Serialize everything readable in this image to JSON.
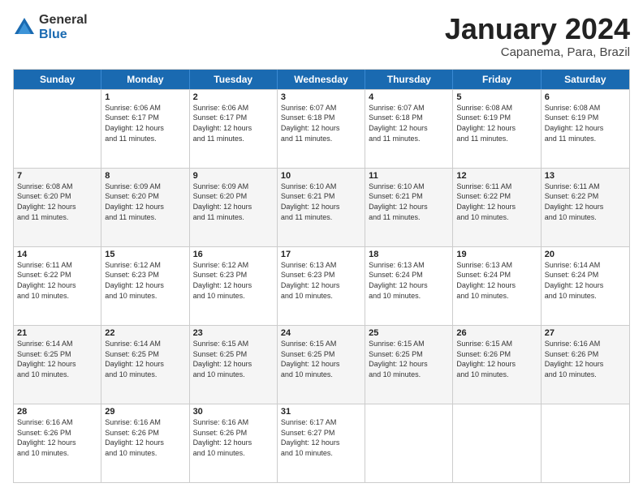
{
  "logo": {
    "general": "General",
    "blue": "Blue"
  },
  "title": "January 2024",
  "location": "Capanema, Para, Brazil",
  "days": [
    "Sunday",
    "Monday",
    "Tuesday",
    "Wednesday",
    "Thursday",
    "Friday",
    "Saturday"
  ],
  "weeks": [
    [
      {
        "day": "",
        "lines": []
      },
      {
        "day": "1",
        "lines": [
          "Sunrise: 6:06 AM",
          "Sunset: 6:17 PM",
          "Daylight: 12 hours",
          "and 11 minutes."
        ]
      },
      {
        "day": "2",
        "lines": [
          "Sunrise: 6:06 AM",
          "Sunset: 6:17 PM",
          "Daylight: 12 hours",
          "and 11 minutes."
        ]
      },
      {
        "day": "3",
        "lines": [
          "Sunrise: 6:07 AM",
          "Sunset: 6:18 PM",
          "Daylight: 12 hours",
          "and 11 minutes."
        ]
      },
      {
        "day": "4",
        "lines": [
          "Sunrise: 6:07 AM",
          "Sunset: 6:18 PM",
          "Daylight: 12 hours",
          "and 11 minutes."
        ]
      },
      {
        "day": "5",
        "lines": [
          "Sunrise: 6:08 AM",
          "Sunset: 6:19 PM",
          "Daylight: 12 hours",
          "and 11 minutes."
        ]
      },
      {
        "day": "6",
        "lines": [
          "Sunrise: 6:08 AM",
          "Sunset: 6:19 PM",
          "Daylight: 12 hours",
          "and 11 minutes."
        ]
      }
    ],
    [
      {
        "day": "7",
        "lines": [
          "Sunrise: 6:08 AM",
          "Sunset: 6:20 PM",
          "Daylight: 12 hours",
          "and 11 minutes."
        ]
      },
      {
        "day": "8",
        "lines": [
          "Sunrise: 6:09 AM",
          "Sunset: 6:20 PM",
          "Daylight: 12 hours",
          "and 11 minutes."
        ]
      },
      {
        "day": "9",
        "lines": [
          "Sunrise: 6:09 AM",
          "Sunset: 6:20 PM",
          "Daylight: 12 hours",
          "and 11 minutes."
        ]
      },
      {
        "day": "10",
        "lines": [
          "Sunrise: 6:10 AM",
          "Sunset: 6:21 PM",
          "Daylight: 12 hours",
          "and 11 minutes."
        ]
      },
      {
        "day": "11",
        "lines": [
          "Sunrise: 6:10 AM",
          "Sunset: 6:21 PM",
          "Daylight: 12 hours",
          "and 11 minutes."
        ]
      },
      {
        "day": "12",
        "lines": [
          "Sunrise: 6:11 AM",
          "Sunset: 6:22 PM",
          "Daylight: 12 hours",
          "and 10 minutes."
        ]
      },
      {
        "day": "13",
        "lines": [
          "Sunrise: 6:11 AM",
          "Sunset: 6:22 PM",
          "Daylight: 12 hours",
          "and 10 minutes."
        ]
      }
    ],
    [
      {
        "day": "14",
        "lines": [
          "Sunrise: 6:11 AM",
          "Sunset: 6:22 PM",
          "Daylight: 12 hours",
          "and 10 minutes."
        ]
      },
      {
        "day": "15",
        "lines": [
          "Sunrise: 6:12 AM",
          "Sunset: 6:23 PM",
          "Daylight: 12 hours",
          "and 10 minutes."
        ]
      },
      {
        "day": "16",
        "lines": [
          "Sunrise: 6:12 AM",
          "Sunset: 6:23 PM",
          "Daylight: 12 hours",
          "and 10 minutes."
        ]
      },
      {
        "day": "17",
        "lines": [
          "Sunrise: 6:13 AM",
          "Sunset: 6:23 PM",
          "Daylight: 12 hours",
          "and 10 minutes."
        ]
      },
      {
        "day": "18",
        "lines": [
          "Sunrise: 6:13 AM",
          "Sunset: 6:24 PM",
          "Daylight: 12 hours",
          "and 10 minutes."
        ]
      },
      {
        "day": "19",
        "lines": [
          "Sunrise: 6:13 AM",
          "Sunset: 6:24 PM",
          "Daylight: 12 hours",
          "and 10 minutes."
        ]
      },
      {
        "day": "20",
        "lines": [
          "Sunrise: 6:14 AM",
          "Sunset: 6:24 PM",
          "Daylight: 12 hours",
          "and 10 minutes."
        ]
      }
    ],
    [
      {
        "day": "21",
        "lines": [
          "Sunrise: 6:14 AM",
          "Sunset: 6:25 PM",
          "Daylight: 12 hours",
          "and 10 minutes."
        ]
      },
      {
        "day": "22",
        "lines": [
          "Sunrise: 6:14 AM",
          "Sunset: 6:25 PM",
          "Daylight: 12 hours",
          "and 10 minutes."
        ]
      },
      {
        "day": "23",
        "lines": [
          "Sunrise: 6:15 AM",
          "Sunset: 6:25 PM",
          "Daylight: 12 hours",
          "and 10 minutes."
        ]
      },
      {
        "day": "24",
        "lines": [
          "Sunrise: 6:15 AM",
          "Sunset: 6:25 PM",
          "Daylight: 12 hours",
          "and 10 minutes."
        ]
      },
      {
        "day": "25",
        "lines": [
          "Sunrise: 6:15 AM",
          "Sunset: 6:25 PM",
          "Daylight: 12 hours",
          "and 10 minutes."
        ]
      },
      {
        "day": "26",
        "lines": [
          "Sunrise: 6:15 AM",
          "Sunset: 6:26 PM",
          "Daylight: 12 hours",
          "and 10 minutes."
        ]
      },
      {
        "day": "27",
        "lines": [
          "Sunrise: 6:16 AM",
          "Sunset: 6:26 PM",
          "Daylight: 12 hours",
          "and 10 minutes."
        ]
      }
    ],
    [
      {
        "day": "28",
        "lines": [
          "Sunrise: 6:16 AM",
          "Sunset: 6:26 PM",
          "Daylight: 12 hours",
          "and 10 minutes."
        ]
      },
      {
        "day": "29",
        "lines": [
          "Sunrise: 6:16 AM",
          "Sunset: 6:26 PM",
          "Daylight: 12 hours",
          "and 10 minutes."
        ]
      },
      {
        "day": "30",
        "lines": [
          "Sunrise: 6:16 AM",
          "Sunset: 6:26 PM",
          "Daylight: 12 hours",
          "and 10 minutes."
        ]
      },
      {
        "day": "31",
        "lines": [
          "Sunrise: 6:17 AM",
          "Sunset: 6:27 PM",
          "Daylight: 12 hours",
          "and 10 minutes."
        ]
      },
      {
        "day": "",
        "lines": []
      },
      {
        "day": "",
        "lines": []
      },
      {
        "day": "",
        "lines": []
      }
    ]
  ]
}
